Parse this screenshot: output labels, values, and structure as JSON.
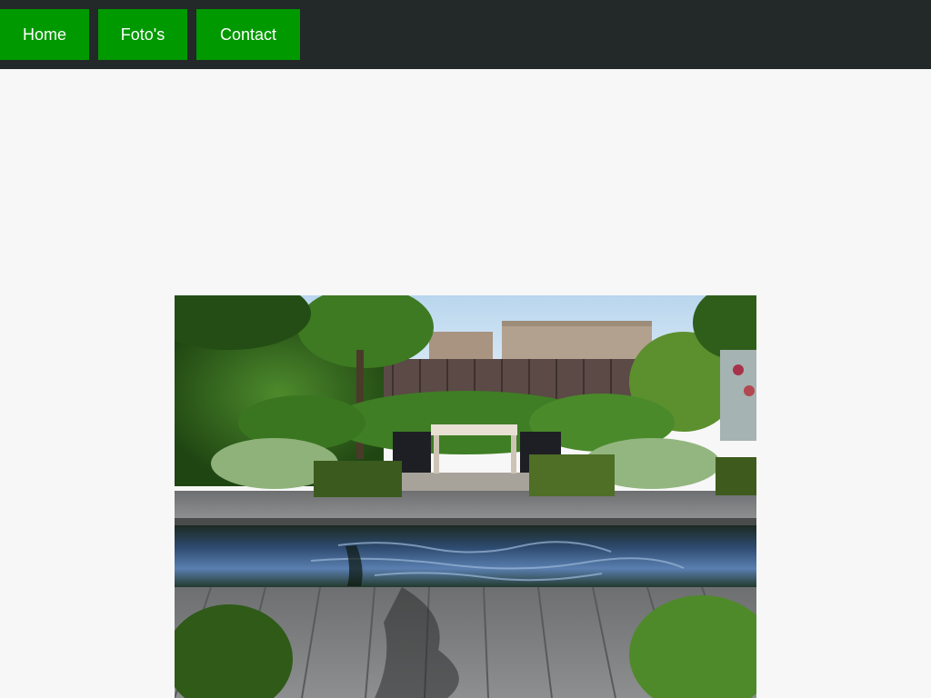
{
  "nav": {
    "items": [
      {
        "label": "Home"
      },
      {
        "label": "Foto's"
      },
      {
        "label": "Contact"
      }
    ]
  },
  "colors": {
    "nav_bg": "#232829",
    "button_bg": "#009900",
    "button_text": "#ffffff",
    "page_bg": "#f7f7f7"
  },
  "main": {
    "image": "garden-photo"
  }
}
